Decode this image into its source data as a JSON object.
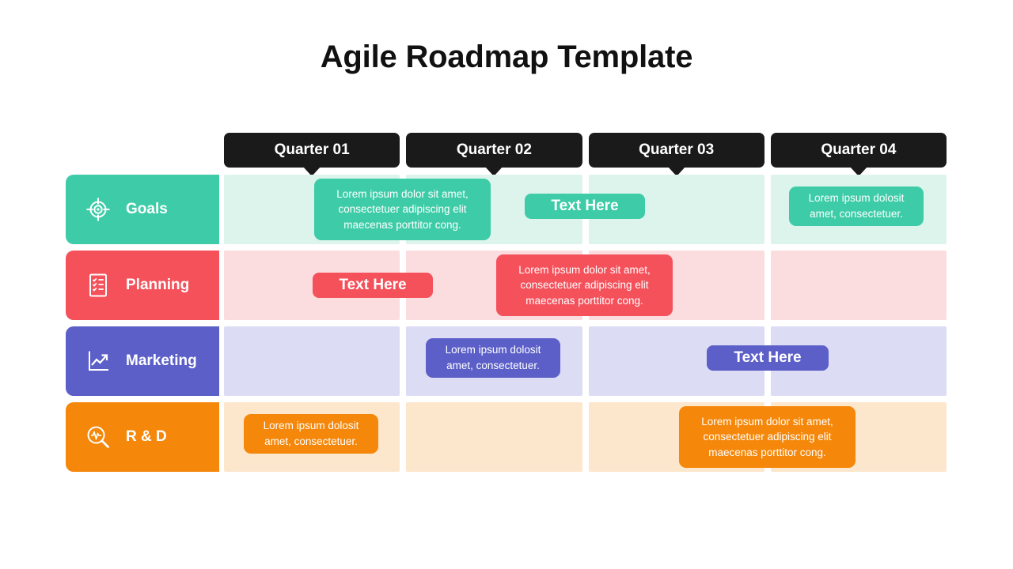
{
  "page": {
    "title": "Agile Roadmap Template"
  },
  "colors": {
    "header_chip": "#1a1a1a",
    "goals": "#3ECCA8",
    "goals_tint": "#DDF4EC",
    "planning": "#F4515B",
    "planning_tint": "#FBDCDF",
    "marketing": "#5B5FC7",
    "marketing_tint": "#DCDCF5",
    "rnd": "#F5870A",
    "rnd_tint": "#FCE6CC",
    "title_color": "#111111"
  },
  "quarters": [
    {
      "label": "Quarter 01"
    },
    {
      "label": "Quarter 02"
    },
    {
      "label": "Quarter 03"
    },
    {
      "label": "Quarter 04"
    }
  ],
  "tracks": [
    {
      "label": "Goals",
      "icon": "target-icon",
      "color": "#3ECCA8",
      "tint": "#DDF4EC"
    },
    {
      "label": "Planning",
      "icon": "checklist-icon",
      "color": "#F4515B",
      "tint": "#FBDCDF"
    },
    {
      "label": "Marketing",
      "icon": "line-chart-icon",
      "color": "#5B5FC7",
      "tint": "#DCDCF5"
    },
    {
      "label": "R & D",
      "icon": "magnifier-pulse-icon",
      "color": "#F5870A",
      "tint": "#FCE6CC"
    }
  ],
  "cards": {
    "goals_long": "Lorem ipsum dolor sit amet, consectetuer adipiscing elit maecenas porttitor cong.",
    "goals_pill": "Text Here",
    "goals_short": "Lorem ipsum dolosit amet, consectetuer.",
    "planning_pill": "Text Here",
    "planning_long": "Lorem ipsum dolor sit amet, consectetuer adipiscing elit maecenas porttitor cong.",
    "marketing_short": "Lorem ipsum dolosit amet, consectetuer.",
    "marketing_pill": "Text Here",
    "rnd_short": "Lorem ipsum dolosit amet, consectetuer.",
    "rnd_long": "Lorem ipsum dolor sit amet, consectetuer adipiscing elit maecenas porttitor cong."
  }
}
